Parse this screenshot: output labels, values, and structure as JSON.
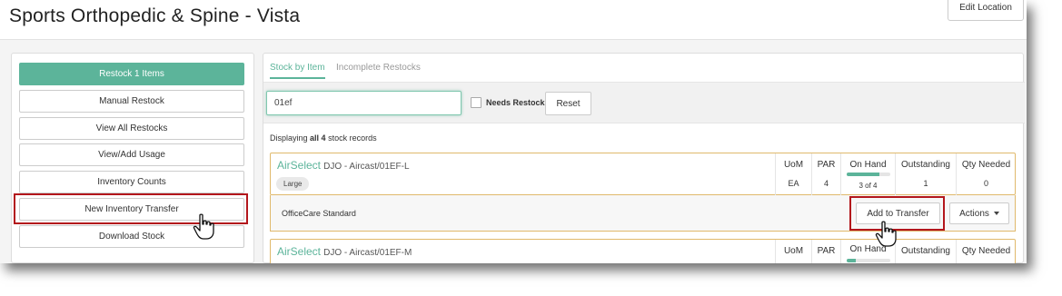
{
  "header": {
    "title": "Sports Orthopedic & Spine - Vista",
    "edit_location_label": "Edit Location"
  },
  "sidebar": {
    "items": [
      {
        "label": "Restock 1 Items",
        "primary": true
      },
      {
        "label": "Manual Restock"
      },
      {
        "label": "View All Restocks"
      },
      {
        "label": "View/Add Usage"
      },
      {
        "label": "Inventory Counts"
      },
      {
        "label": "New Inventory Transfer",
        "highlighted": true
      },
      {
        "label": "Download Stock"
      }
    ]
  },
  "tabs": [
    {
      "label": "Stock by Item",
      "active": true
    },
    {
      "label": "Incomplete Restocks",
      "active": false
    }
  ],
  "filters": {
    "search_value": "01ef",
    "needs_restock_label": "Needs Restock",
    "needs_restock_checked": false,
    "reset_label": "Reset"
  },
  "results": {
    "prefix": "Displaying",
    "bold": "all 4",
    "suffix": "stock records"
  },
  "columns": {
    "uom": "UoM",
    "par": "PAR",
    "on_hand": "On Hand",
    "outstanding": "Outstanding",
    "qty_needed": "Qty Needed"
  },
  "items": [
    {
      "brand": "AirSelect",
      "desc": "DJO - Aircast/01EF-L",
      "size": "Large",
      "uom": "EA",
      "par": "4",
      "on_hand_text": "3 of 4",
      "on_hand_fraction": 0.75,
      "outstanding": "1",
      "qty_needed": "0",
      "sub_label": "OfficeCare Standard",
      "add_transfer_label": "Add to Transfer",
      "actions_label": "Actions"
    },
    {
      "brand": "AirSelect",
      "desc": "DJO - Aircast/01EF-M",
      "on_hand_fraction": 0.2
    }
  ],
  "colors": {
    "accent": "#5cb49a",
    "highlight": "#b3161c",
    "card_border": "#e0b96c"
  }
}
